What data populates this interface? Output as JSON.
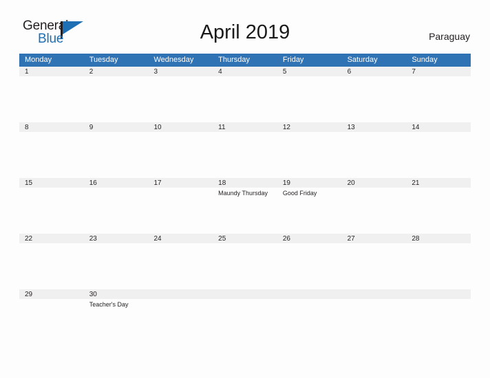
{
  "brand": {
    "name_top": "General",
    "name_bottom": "Blue",
    "color_primary": "#1f6fb5",
    "color_text": "#231f20"
  },
  "header": {
    "title": "April 2019",
    "region": "Paraguay"
  },
  "calendar": {
    "header_background": "#3073b5",
    "band_background": "#f0f0f0",
    "rule_color": "#2e6da4",
    "weekdays": [
      "Monday",
      "Tuesday",
      "Wednesday",
      "Thursday",
      "Friday",
      "Saturday",
      "Sunday"
    ],
    "weeks": [
      [
        {
          "day": "1",
          "events": []
        },
        {
          "day": "2",
          "events": []
        },
        {
          "day": "3",
          "events": []
        },
        {
          "day": "4",
          "events": []
        },
        {
          "day": "5",
          "events": []
        },
        {
          "day": "6",
          "events": []
        },
        {
          "day": "7",
          "events": []
        }
      ],
      [
        {
          "day": "8",
          "events": []
        },
        {
          "day": "9",
          "events": []
        },
        {
          "day": "10",
          "events": []
        },
        {
          "day": "11",
          "events": []
        },
        {
          "day": "12",
          "events": []
        },
        {
          "day": "13",
          "events": []
        },
        {
          "day": "14",
          "events": []
        }
      ],
      [
        {
          "day": "15",
          "events": []
        },
        {
          "day": "16",
          "events": []
        },
        {
          "day": "17",
          "events": []
        },
        {
          "day": "18",
          "events": [
            "Maundy Thursday"
          ]
        },
        {
          "day": "19",
          "events": [
            "Good Friday"
          ]
        },
        {
          "day": "20",
          "events": []
        },
        {
          "day": "21",
          "events": []
        }
      ],
      [
        {
          "day": "22",
          "events": []
        },
        {
          "day": "23",
          "events": []
        },
        {
          "day": "24",
          "events": []
        },
        {
          "day": "25",
          "events": []
        },
        {
          "day": "26",
          "events": []
        },
        {
          "day": "27",
          "events": []
        },
        {
          "day": "28",
          "events": []
        }
      ],
      [
        {
          "day": "29",
          "events": []
        },
        {
          "day": "30",
          "events": [
            "Teacher's Day"
          ]
        },
        {
          "day": "",
          "events": []
        },
        {
          "day": "",
          "events": []
        },
        {
          "day": "",
          "events": []
        },
        {
          "day": "",
          "events": []
        },
        {
          "day": "",
          "events": []
        }
      ]
    ]
  }
}
